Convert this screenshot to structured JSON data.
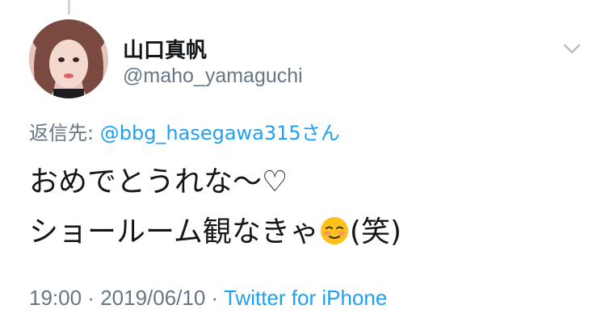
{
  "author": {
    "display_name": "山口真帆",
    "handle": "@maho_yamaguchi"
  },
  "reply": {
    "prefix": "返信先: ",
    "mention": "@bbg_hasegawa315",
    "suffix": "さん"
  },
  "body": {
    "line1": "おめでとうれな〜♡",
    "line2_before": "ショールーム観なきゃ",
    "line2_emoji": "smiling-face-emoji",
    "line2_after": "(笑)"
  },
  "meta": {
    "time": "19:00",
    "separator": " · ",
    "date": "2019/06/10",
    "separator2": " · ",
    "source": "Twitter for iPhone"
  },
  "icons": {
    "caret": "chevron-down-icon"
  },
  "colors": {
    "link": "#1da1f2",
    "secondary": "#657786",
    "text": "#14171a"
  }
}
